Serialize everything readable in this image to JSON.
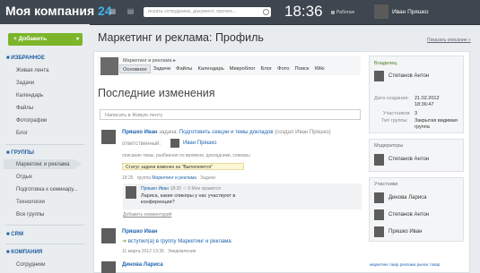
{
  "topbar": {
    "logo_text": "Моя компания",
    "logo_number": "24",
    "search_placeholder": "искать сотрудника, документ, прочее...",
    "time": "18:36",
    "work_label": "Работаю",
    "user_name": "Иван Пряшко"
  },
  "sidebar": {
    "add_button": "+ Добавить",
    "favorites_title": "ИЗБРАННОЕ",
    "favorites_items": [
      "Живая лента",
      "Задачи",
      "Календарь",
      "Файлы",
      "Фотографии",
      "Блог"
    ],
    "groups_title": "ГРУППЫ",
    "groups_items": [
      "Маркетинг и реклама",
      "Отдых",
      "Подготовка к семинару...",
      "Технологии",
      "Все группы"
    ],
    "crm_title": "CRM",
    "company_title": "КОМПАНИЯ",
    "company_items": [
      "Сотрудники"
    ]
  },
  "page": {
    "title": "Маркетинг и реклама: Профиль",
    "change_desc": "Показать описание »",
    "group_name": "Маркетинг и реклама",
    "tabs": [
      "Основное",
      "Задачи",
      "Файлы",
      "Календарь",
      "Микроблог",
      "Блог",
      "Фото",
      "Поиск",
      "Wiki"
    ],
    "recent_title": "Последние изменения",
    "post_placeholder": "Написать в Живую ленту"
  },
  "feed": {
    "entry1": {
      "author": "Пряшко Иван",
      "action": "задача:",
      "task": "Подготовить секции и темы докладов",
      "created_by": "(создал Иван Пряшко)",
      "responsible_label": "ответственный:",
      "responsible": "Иван Пряшко",
      "description": "описание темы, разбиение по времени, докладчики, спикеры",
      "status": "Статус задачи изменен на \"Выполняется\"",
      "time": "18:25",
      "group_prefix": "группа",
      "group": "Маркетинг и реклама",
      "type": "Задачи",
      "comment_author": "Пряшко Иван",
      "comment_time": "18:26",
      "comment_likes": "0 Мне нравится",
      "comment_text": "Лариса, какие спикеры у нас участвуют в конференции?",
      "add_comment": "Добавить комментарий"
    },
    "entry2": {
      "author": "Пряшко Иван",
      "text": "вступил(а) в группу Маркетинг и реклама",
      "date": "11 марта 2012 13:36",
      "type": "Уведомления"
    },
    "entry3": {
      "author": "Динова Лариса"
    }
  },
  "right": {
    "owner_title": "Владелец",
    "owner_name": "Степанов Антон",
    "created_label": "Дата создания:",
    "created_value": "21.02.2012 18:36:47",
    "members_label": "Участников:",
    "members_value": "3",
    "type_label": "Тип группы:",
    "type_value": "Закрытая видимая группа",
    "moderators_title": "Модераторы",
    "moderator_name": "Степанов Антон",
    "participants_title": "Участники",
    "participants": [
      "Динова Лариса",
      "Степанов Антон",
      "Пряшко Иван"
    ],
    "tags": "маркетинг пиар реклама рынок товар"
  }
}
